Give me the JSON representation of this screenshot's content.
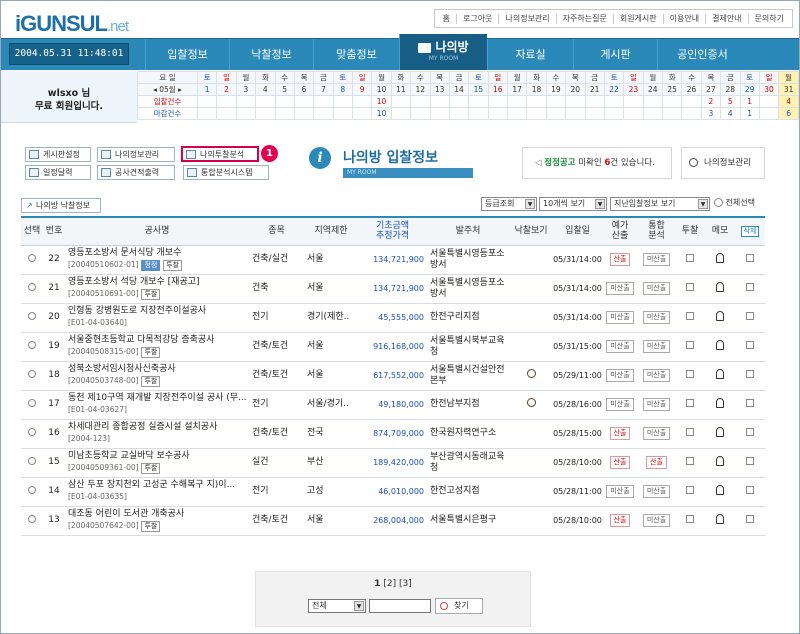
{
  "brand": {
    "logo_main": "iGUNSUL",
    "logo_suffix": ".net"
  },
  "top_links": [
    "홈",
    "로그아웃",
    "나의정보관리",
    "자주하는질문",
    "회원게시판",
    "이용안내",
    "결제안내",
    "문의하기"
  ],
  "datetime": "2004.05.31 11:48:01",
  "nav": {
    "items": [
      "입찰정보",
      "낙찰정보",
      "맞춤정보",
      "나의방",
      "자료실",
      "게시판",
      "공인인증서"
    ],
    "active_sub": "MY ROOM"
  },
  "user": {
    "line1": "wlsxo 님",
    "line2": "무료 회원입니다."
  },
  "calendar": {
    "month_label": "05월",
    "row_labels": {
      "weekday": "요 일",
      "tender": "입찰건수",
      "deadline": "마감건수"
    },
    "weekdays": [
      "토",
      "일",
      "월",
      "화",
      "수",
      "목",
      "금",
      "토",
      "일",
      "월",
      "화",
      "수",
      "목",
      "금",
      "토",
      "일",
      "월",
      "화",
      "수",
      "목",
      "금",
      "토",
      "일",
      "월",
      "화",
      "수",
      "목",
      "금",
      "토",
      "일",
      "월"
    ],
    "days": [
      "1",
      "2",
      "3",
      "4",
      "5",
      "6",
      "7",
      "8",
      "9",
      "10",
      "11",
      "12",
      "13",
      "14",
      "15",
      "16",
      "17",
      "18",
      "19",
      "20",
      "21",
      "22",
      "23",
      "24",
      "25",
      "26",
      "27",
      "28",
      "29",
      "30",
      "31"
    ],
    "tender": [
      "",
      "",
      "",
      "",
      "",
      "",
      "",
      "",
      "",
      "10",
      "",
      "",
      "",
      "",
      "",
      "",
      "",
      "",
      "",
      "",
      "",
      "",
      "",
      "",
      "",
      "",
      "2",
      "5",
      "1",
      "",
      "4"
    ],
    "deadline": [
      "",
      "",
      "",
      "",
      "",
      "",
      "",
      "",
      "",
      "10",
      "",
      "",
      "",
      "",
      "",
      "",
      "",
      "",
      "",
      "",
      "",
      "",
      "",
      "",
      "",
      "",
      "3",
      "4",
      "1",
      "",
      "6"
    ]
  },
  "menu_buttons": [
    "게시판설정",
    "나의정보관리",
    "나의투찰분석",
    "일정달력",
    "공사견적출력",
    "통합분석시스템"
  ],
  "selected_badge": "1",
  "page_title": {
    "title": "나의방 입찰정보",
    "sub": "MY ROOM"
  },
  "notice": {
    "prefix": "정정공고",
    "middle": " 미확인 ",
    "count": "6",
    "suffix": "건 있습니다."
  },
  "manage_btn": "나의정보관리",
  "mybid_link": "나의방 낙찰정보",
  "filters": {
    "sort": "등급조회",
    "per_page": "10개씩 보기",
    "region": "지난입찰정보 보기",
    "select_all": "전체선택"
  },
  "table": {
    "headers": {
      "select": "선택",
      "no": "번호",
      "title": "공사명",
      "type": "종목",
      "region": "지역제한",
      "amount_1": "기초금액",
      "amount_2": "추정가격",
      "issuer": "발주처",
      "bid_view": "낙찰보기",
      "date": "입찰일",
      "pre_1": "예가",
      "pre_2": "산출",
      "an_1": "통합",
      "an_2": "분석",
      "bid": "투찰",
      "memo": "메모",
      "delete": "삭제"
    },
    "rows": [
      {
        "no": "22",
        "title": "영등포소방서 문서식당 개보수",
        "code": "[20040510602-01]",
        "tags": [
          "정정",
          "투찰"
        ],
        "type": "건축/실건",
        "region": "서울",
        "amount": "134,721,900",
        "issuer": "서울특별시영등포소방서",
        "bid_view": false,
        "date": "05/31/14:00",
        "pre": "산출",
        "pre_red": true,
        "an": "미산출",
        "an_red": false
      },
      {
        "no": "21",
        "title": "영등포소방서 석당 개보수 [재공고]",
        "code": "[20040510691-00]",
        "tags": [
          "투찰"
        ],
        "type": "건축",
        "region": "서울",
        "amount": "134,721,900",
        "issuer": "서울특별시영등포소방서",
        "bid_view": false,
        "date": "05/31/14:00",
        "pre": "미산출",
        "pre_red": false,
        "an": "미산출",
        "an_red": false
      },
      {
        "no": "20",
        "title": "인형동 강병원도로 지장전주이설공사",
        "code": "[E01-04-03640]",
        "tags": [],
        "type": "전기",
        "region": "경기(제한..",
        "amount": "45,555,000",
        "issuer": "한전구리지점",
        "bid_view": false,
        "date": "05/31/14:00",
        "pre": "미산출",
        "pre_red": false,
        "an": "미산출",
        "an_red": false
      },
      {
        "no": "19",
        "title": "서울중현초등학교 다목적강당 증축공사",
        "code": "[20040508315-00]",
        "tags": [
          "투찰"
        ],
        "type": "건축/토건",
        "region": "서울",
        "amount": "916,168,000",
        "issuer": "서울특별시북부교육청",
        "bid_view": false,
        "date": "05/31/15:00",
        "pre": "미산출",
        "pre_red": false,
        "an": "미산출",
        "an_red": false
      },
      {
        "no": "18",
        "title": "성북소방서임시청사신축공사",
        "code": "[20040503748-00]",
        "tags": [
          "투찰"
        ],
        "type": "건축/토건",
        "region": "서울",
        "amount": "617,552,000",
        "issuer": "서울특별시건설안전본부",
        "bid_view": true,
        "date": "05/29/11:00",
        "pre": "미산출",
        "pre_red": false,
        "an": "미산출",
        "an_red": false
      },
      {
        "no": "17",
        "title": "동천 제10구역 재개발 지장전주이설 공사 (무...",
        "code": "[E01-04-03627]",
        "tags": [],
        "type": "전기",
        "region": "서울/경기..",
        "amount": "49,180,000",
        "issuer": "한전남부지점",
        "bid_view": true,
        "date": "05/28/16:00",
        "pre": "미산출",
        "pre_red": false,
        "an": "미산출",
        "an_red": false
      },
      {
        "no": "16",
        "title": "차세대관리 종합공정 실증시설 설치공사",
        "code": "[2004-123]",
        "tags": [],
        "type": "건축/토건",
        "region": "전국",
        "amount": "874,709,000",
        "issuer": "한국원자력연구소",
        "bid_view": false,
        "date": "05/28/15:00",
        "pre": "산출",
        "pre_red": true,
        "an": "미산출",
        "an_red": false
      },
      {
        "no": "15",
        "title": "미남초등학교 교실바닥 보수공사",
        "code": "[20040509361-00]",
        "tags": [
          "투찰"
        ],
        "type": "실건",
        "region": "부산",
        "amount": "189,420,000",
        "issuer": "부산광역시동래교육청",
        "bid_view": false,
        "date": "05/28/10:00",
        "pre": "산출",
        "pre_red": true,
        "an": "산출",
        "an_red": true
      },
      {
        "no": "14",
        "title": "삼산 두포 장지천외 고성군 수해복구 지)이...",
        "code": "[E01-04-03635]",
        "tags": [],
        "type": "전기",
        "region": "고성",
        "amount": "46,010,000",
        "issuer": "한전고성지점",
        "bid_view": false,
        "date": "05/28/11:00",
        "pre": "미산출",
        "pre_red": false,
        "an": "미산출",
        "an_red": false
      },
      {
        "no": "13",
        "title": "대조동 어린이 도서관 개축공사",
        "code": "[20040507642-00]",
        "tags": [
          "투찰"
        ],
        "type": "건축/토건",
        "region": "서울",
        "amount": "268,004,000",
        "issuer": "서울특별시은평구",
        "bid_view": false,
        "date": "05/28/10:00",
        "pre": "산출",
        "pre_red": true,
        "an": "미산출",
        "an_red": false
      }
    ]
  },
  "pagination": {
    "current": "1",
    "others": [
      "[2]",
      "[3]"
    ],
    "select": "전체",
    "search_btn": "찾기"
  },
  "colors": {
    "primary": "#2a89b8",
    "active": "#175d85",
    "accent": "#e5004f",
    "amount": "#1a4fbf"
  }
}
